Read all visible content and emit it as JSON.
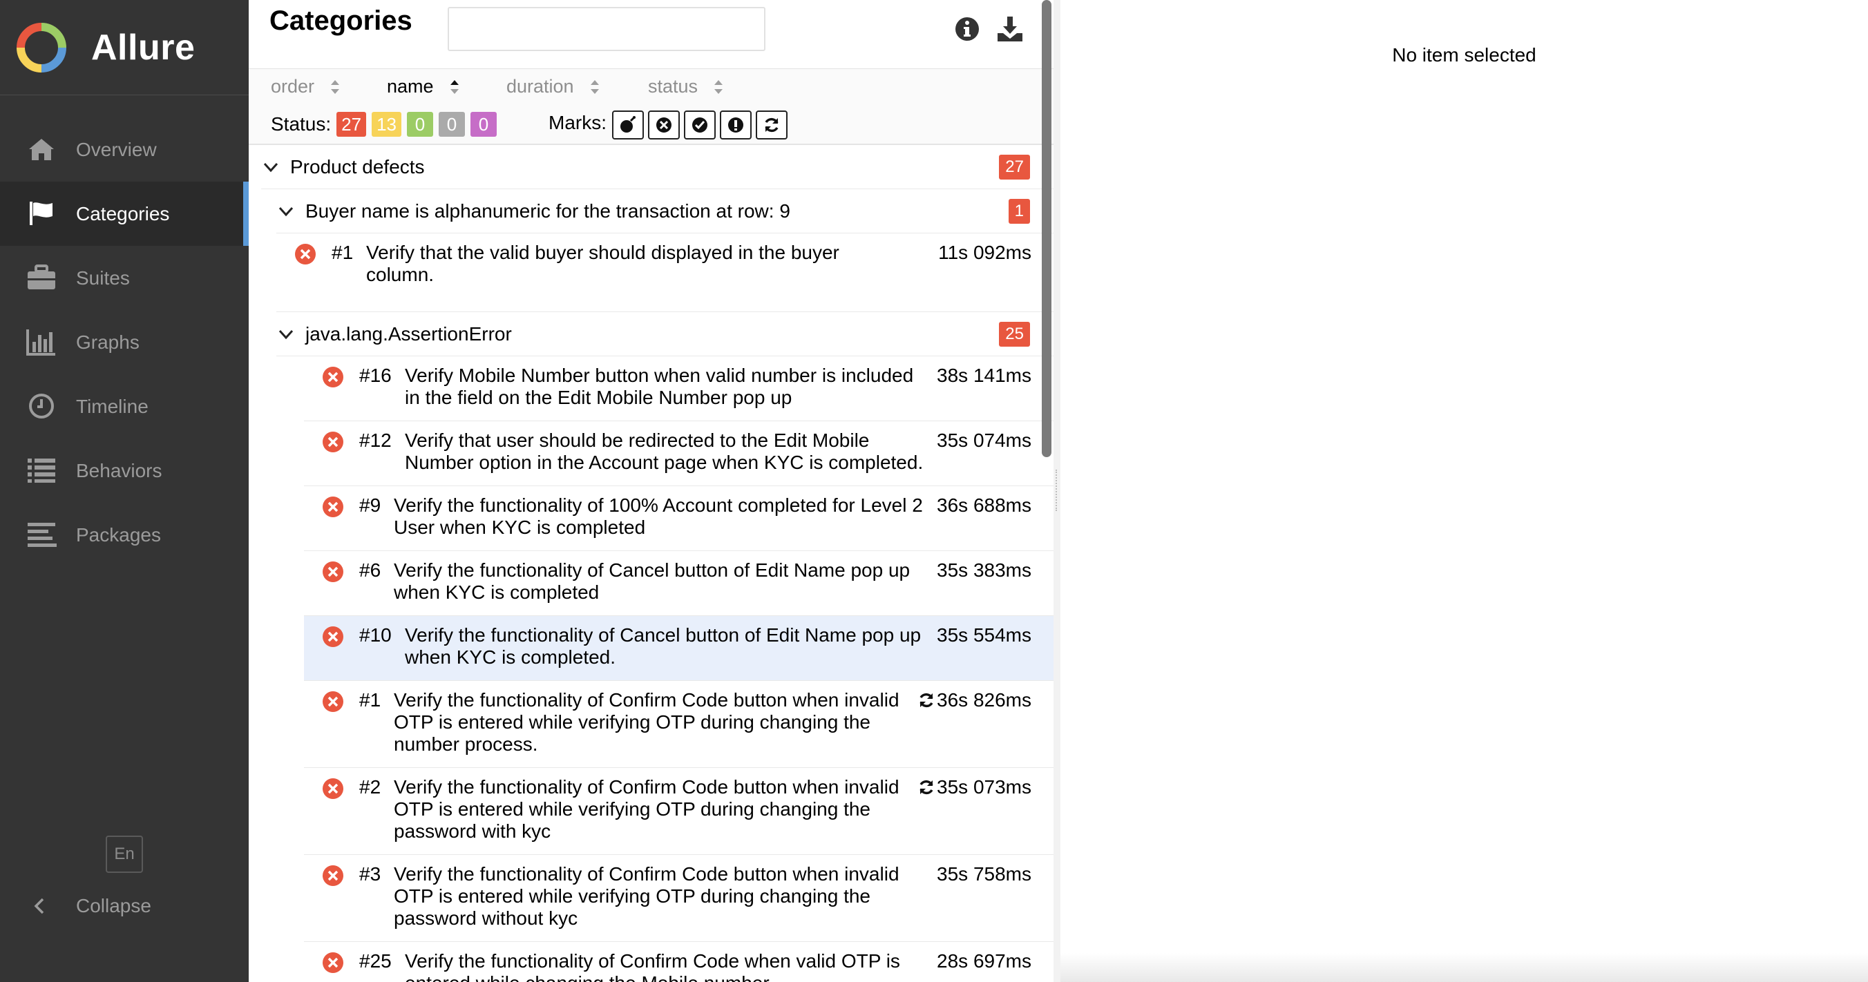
{
  "app": {
    "name": "Allure"
  },
  "sidebar": {
    "items": [
      {
        "label": "Overview",
        "icon": "home-icon",
        "active": false
      },
      {
        "label": "Categories",
        "icon": "flag-icon",
        "active": true
      },
      {
        "label": "Suites",
        "icon": "briefcase-icon",
        "active": false
      },
      {
        "label": "Graphs",
        "icon": "bar-chart-icon",
        "active": false
      },
      {
        "label": "Timeline",
        "icon": "clock-icon",
        "active": false
      },
      {
        "label": "Behaviors",
        "icon": "list-icon",
        "active": false
      },
      {
        "label": "Packages",
        "icon": "align-left-icon",
        "active": false
      }
    ],
    "language": "En",
    "collapse_label": "Collapse"
  },
  "pane": {
    "title": "Categories",
    "search": {
      "value": "",
      "placeholder": ""
    },
    "sort": [
      {
        "label": "order",
        "active": false
      },
      {
        "label": "name",
        "active": true
      },
      {
        "label": "duration",
        "active": false
      },
      {
        "label": "status",
        "active": false
      }
    ],
    "status_label": "Status:",
    "status_counts": [
      {
        "value": "27",
        "color": "#e8573f",
        "status": "failed"
      },
      {
        "value": "13",
        "color": "#f7d359",
        "status": "broken"
      },
      {
        "value": "0",
        "color": "#9ccc65",
        "status": "passed"
      },
      {
        "value": "0",
        "color": "#aaaaaa",
        "status": "skipped"
      },
      {
        "value": "0",
        "color": "#c66dc7",
        "status": "unknown"
      }
    ],
    "marks_label": "Marks:",
    "marks": [
      "flaky-bomb-icon",
      "new-failed-icon",
      "new-passed-icon",
      "new-broken-icon",
      "retries-icon"
    ]
  },
  "tree": {
    "category": {
      "label": "Product defects",
      "count": "27"
    },
    "groups": [
      {
        "label": "Buyer name is alphanumeric for the transaction at row: 9",
        "count": "1",
        "tests": [
          {
            "num": "#1",
            "lines": [
              "Verify that the valid buyer should displayed in the buyer",
              "column."
            ],
            "duration": "11s 092ms",
            "retries": false,
            "selected": false
          }
        ]
      },
      {
        "label": "java.lang.AssertionError",
        "count": "25",
        "tests": [
          {
            "num": "#16",
            "lines": [
              "Verify Mobile Number button when valid number is included",
              "in the field on the Edit Mobile Number pop up"
            ],
            "duration": "38s 141ms",
            "retries": false,
            "selected": false
          },
          {
            "num": "#12",
            "lines": [
              "Verify that user should be redirected to the Edit Mobile",
              "Number option in the Account page when KYC is completed."
            ],
            "duration": "35s 074ms",
            "retries": false,
            "selected": false
          },
          {
            "num": "#9",
            "lines": [
              "Verify the functionality of 100% Account completed for Level 2",
              "User when KYC is completed"
            ],
            "duration": "36s 688ms",
            "retries": false,
            "selected": false
          },
          {
            "num": "#6",
            "lines": [
              "Verify the functionality of Cancel button of Edit Name pop up",
              "when KYC is completed"
            ],
            "duration": "35s 383ms",
            "retries": false,
            "selected": false
          },
          {
            "num": "#10",
            "lines": [
              "Verify the functionality of Cancel button of Edit Name pop up",
              "when KYC is completed."
            ],
            "duration": "35s 554ms",
            "retries": false,
            "selected": true
          },
          {
            "num": "#1",
            "lines": [
              "Verify the functionality of Confirm Code button when invalid",
              "OTP is entered while verifying OTP during changing the",
              "number process."
            ],
            "duration": "36s 826ms",
            "retries": true,
            "selected": false
          },
          {
            "num": "#2",
            "lines": [
              "Verify the functionality of Confirm Code button when invalid",
              "OTP is entered while verifying OTP during changing the",
              "password with kyc"
            ],
            "duration": "35s 073ms",
            "retries": true,
            "selected": false
          },
          {
            "num": "#3",
            "lines": [
              "Verify the functionality of Confirm Code button when invalid",
              "OTP is entered while verifying OTP during changing the",
              "password without kyc"
            ],
            "duration": "35s 758ms",
            "retries": false,
            "selected": false
          },
          {
            "num": "#25",
            "lines": [
              "Verify the functionality of Confirm Code when valid OTP is",
              "entered while changing the Mobile number"
            ],
            "duration": "28s 697ms",
            "retries": false,
            "selected": false
          }
        ]
      }
    ]
  },
  "details": {
    "empty_text": "No item selected"
  }
}
